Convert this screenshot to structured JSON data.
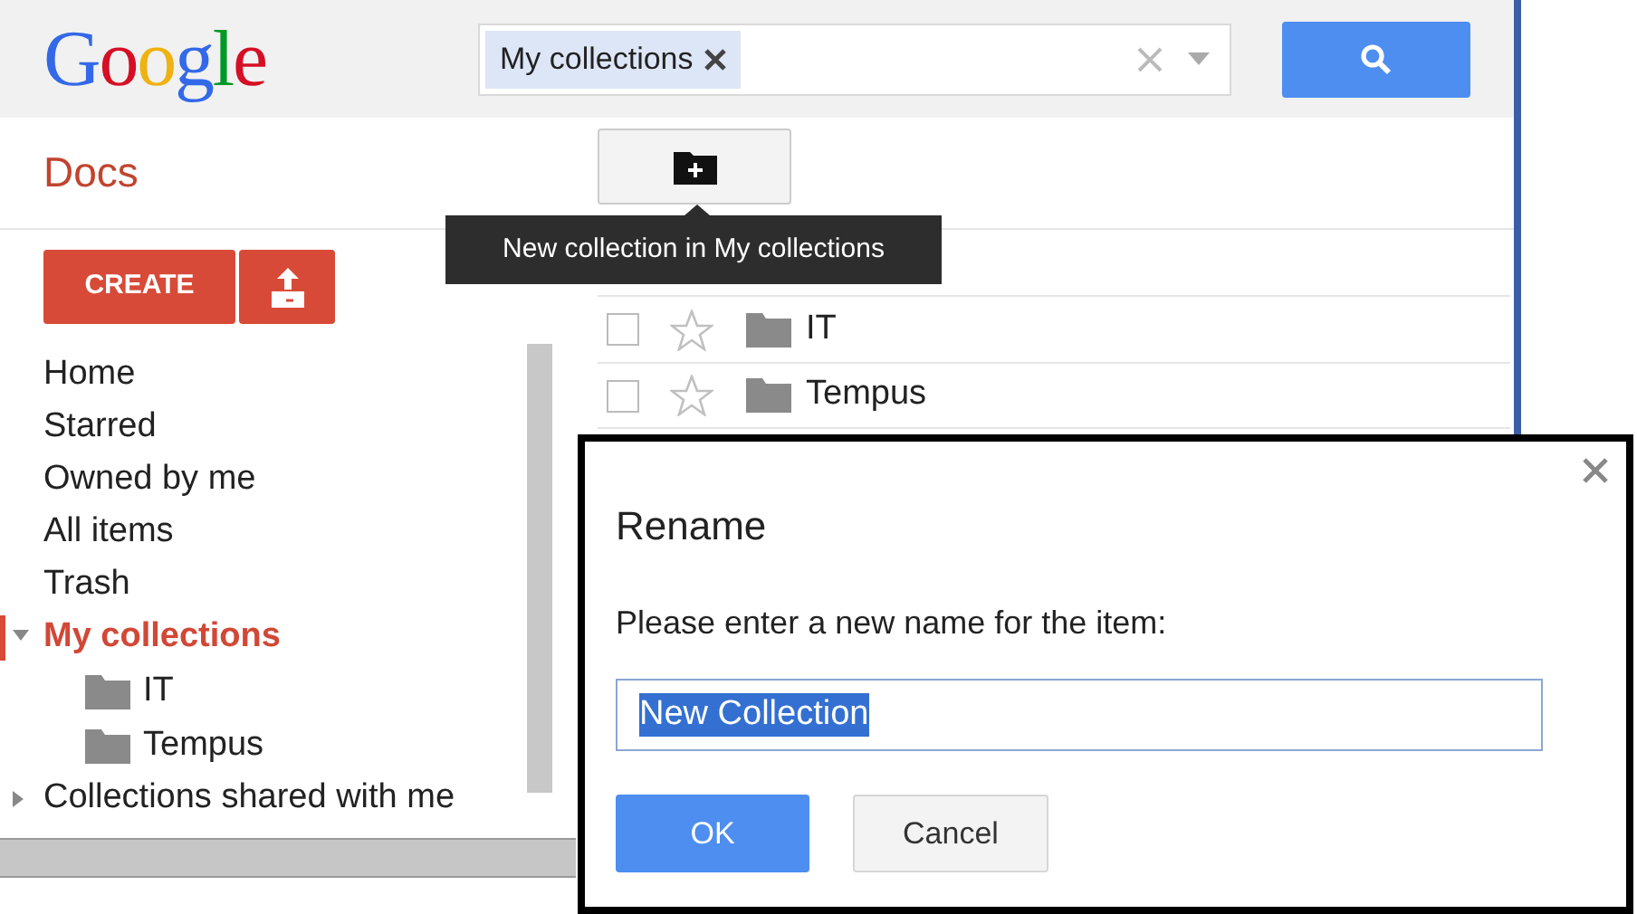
{
  "header": {
    "logo": "Google",
    "search": {
      "chip": "My collections"
    }
  },
  "app_title": "Docs",
  "tooltip": "New collection in My collections",
  "create_button": "CREATE",
  "nav": [
    {
      "label": "Home",
      "kind": "link",
      "selected": false
    },
    {
      "label": "Starred",
      "kind": "link",
      "selected": false
    },
    {
      "label": "Owned by me",
      "kind": "link",
      "selected": false
    },
    {
      "label": "All items",
      "kind": "link",
      "selected": false
    },
    {
      "label": "Trash",
      "kind": "link",
      "selected": false
    },
    {
      "label": "My collections",
      "kind": "group",
      "selected": true,
      "expanded": true,
      "children": [
        {
          "label": "IT"
        },
        {
          "label": "Tempus"
        }
      ]
    },
    {
      "label": "Collections shared with me",
      "kind": "group",
      "selected": false,
      "expanded": false
    }
  ],
  "rows": [
    {
      "name": "IT",
      "checked": false,
      "starred": false
    },
    {
      "name": "Tempus",
      "checked": false,
      "starred": false
    }
  ],
  "dialog": {
    "title": "Rename",
    "prompt": "Please enter a new name for the item:",
    "value": "New Collection",
    "buttons": [
      {
        "label": "OK",
        "kind": "primary"
      },
      {
        "label": "Cancel",
        "kind": "secondary"
      }
    ]
  }
}
